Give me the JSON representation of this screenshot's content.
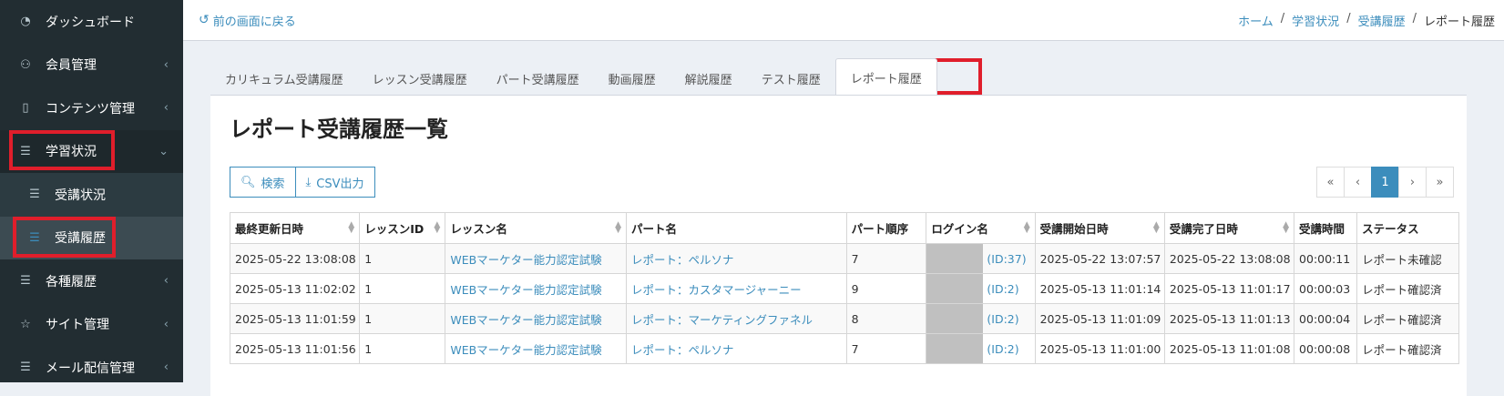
{
  "sidebar": {
    "items": [
      {
        "label": "ダッシュボード",
        "icon": "dashboard-icon",
        "chevron": ""
      },
      {
        "label": "会員管理",
        "icon": "users-icon",
        "chevron": "‹"
      },
      {
        "label": "コンテンツ管理",
        "icon": "book-icon",
        "chevron": "‹"
      },
      {
        "label": "学習状況",
        "icon": "list-icon",
        "chevron": "⌄"
      },
      {
        "label": "受講状況",
        "icon": "list-icon",
        "chevron": ""
      },
      {
        "label": "受講履歴",
        "icon": "list-icon",
        "chevron": ""
      },
      {
        "label": "各種履歴",
        "icon": "list-icon",
        "chevron": "‹"
      },
      {
        "label": "サイト管理",
        "icon": "star-icon",
        "chevron": "‹"
      },
      {
        "label": "メール配信管理",
        "icon": "list-icon",
        "chevron": "‹"
      }
    ]
  },
  "header": {
    "back_label": "前の画面に戻る",
    "breadcrumb": [
      "ホーム",
      "学習状況",
      "受講履歴",
      "レポート履歴"
    ]
  },
  "tabs": [
    "カリキュラム受講履歴",
    "レッスン受講履歴",
    "パート受講履歴",
    "動画履歴",
    "解説履歴",
    "テスト履歴",
    "レポート履歴"
  ],
  "main": {
    "title": "レポート受講履歴一覧",
    "search_label": "検索",
    "csv_label": "CSV出力",
    "pager": [
      "«",
      "‹",
      "1",
      "›",
      "»"
    ]
  },
  "table": {
    "columns": [
      "最終更新日時",
      "レッスンID",
      "レッスン名",
      "パート名",
      "パート順序",
      "ログイン名",
      "受講開始日時",
      "受講完了日時",
      "受講時間",
      "ステータス"
    ],
    "rows": [
      [
        "2025-05-22 13:08:08",
        "1",
        "WEBマーケター能力認定試験",
        "レポート：ペルソナ",
        "7",
        "(ID:37)",
        "2025-05-22 13:07:57",
        "2025-05-22 13:08:08",
        "00:00:11",
        "レポート未確認"
      ],
      [
        "2025-05-13 11:02:02",
        "1",
        "WEBマーケター能力認定試験",
        "レポート：カスタマージャーニー",
        "9",
        "(ID:2)",
        "2025-05-13 11:01:14",
        "2025-05-13 11:01:17",
        "00:00:03",
        "レポート確認済"
      ],
      [
        "2025-05-13 11:01:59",
        "1",
        "WEBマーケター能力認定試験",
        "レポート：マーケティングファネル",
        "8",
        "(ID:2)",
        "2025-05-13 11:01:09",
        "2025-05-13 11:01:13",
        "00:00:04",
        "レポート確認済"
      ],
      [
        "2025-05-13 11:01:56",
        "1",
        "WEBマーケター能力認定試験",
        "レポート：ペルソナ",
        "7",
        "(ID:2)",
        "2025-05-13 11:01:00",
        "2025-05-13 11:01:08",
        "00:00:08",
        "レポート確認済"
      ]
    ]
  }
}
